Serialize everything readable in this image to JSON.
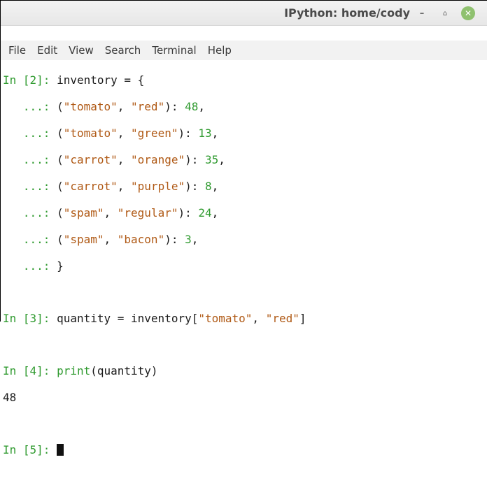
{
  "window": {
    "title": "IPython: home/cody"
  },
  "window_controls": {
    "minimize": "–",
    "maximize": "⌂",
    "close": "✕"
  },
  "menu": [
    "File",
    "Edit",
    "View",
    "Search",
    "Terminal",
    "Help"
  ],
  "terminal": {
    "in2_prompt": "In [2]: ",
    "in2_code": "inventory = {",
    "cont_prompt": "   ...: ",
    "dict_lines": [
      {
        "k1": "\"tomato\"",
        "k2": "\"red\"",
        "v": "48"
      },
      {
        "k1": "\"tomato\"",
        "k2": "\"green\"",
        "v": "13"
      },
      {
        "k1": "\"carrot\"",
        "k2": "\"orange\"",
        "v": "35"
      },
      {
        "k1": "\"carrot\"",
        "k2": "\"purple\"",
        "v": "8"
      },
      {
        "k1": "\"spam\"",
        "k2": "\"regular\"",
        "v": "24"
      },
      {
        "k1": "\"spam\"",
        "k2": "\"bacon\"",
        "v": "3"
      }
    ],
    "dict_close": "}",
    "in3_prompt": "In [3]: ",
    "in3_code_a": "quantity = inventory[",
    "in3_s1": "\"tomato\"",
    "in3_sep": ", ",
    "in3_s2": "\"red\"",
    "in3_close": "]",
    "in4_prompt": "In [4]: ",
    "in4_fn": "print",
    "in4_args": "(quantity)",
    "out4": "48",
    "in5_prompt": "In [5]: "
  },
  "colors": {
    "prompt": "#2f9a2f",
    "string": "#b05a16",
    "number": "#2f9a2f",
    "text": "#1b1b1b"
  }
}
